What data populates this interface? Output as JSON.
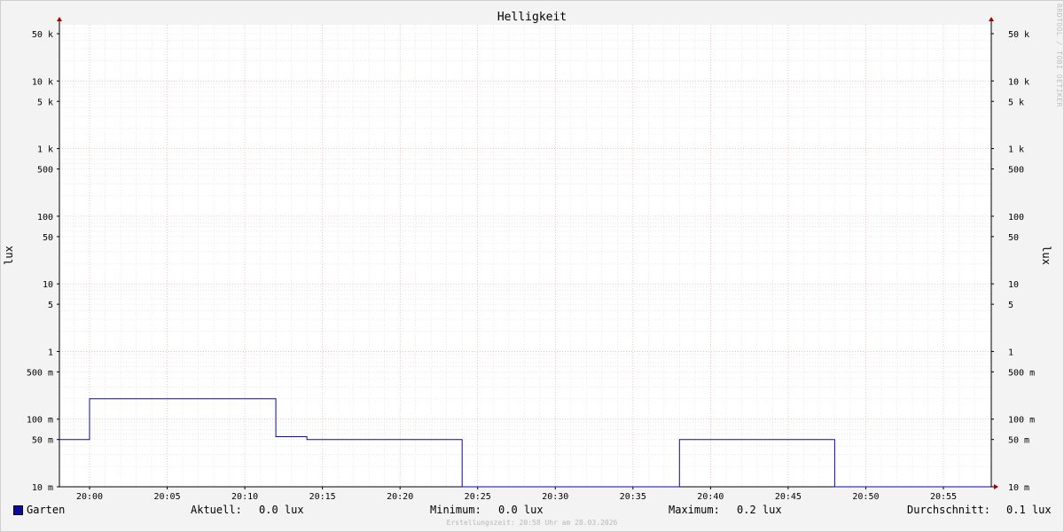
{
  "watermark": "RRDTOOL / TOBI OETIKER",
  "legend": {
    "series_name": "Garten",
    "current_label": "Aktuell:",
    "current_value": "0.0 lux",
    "min_label": "Minimum:",
    "min_value": "0.0 lux",
    "max_label": "Maximum:",
    "max_value": "0.2 lux",
    "avg_label": "Durchschnitt:",
    "avg_value": "0.1 lux"
  },
  "credit": "Erstellungszeit: 20:58 Uhr am 28.03.2026",
  "chart_data": {
    "type": "line",
    "title": "Helligkeit",
    "ylabel": "lux",
    "y_scale": "log",
    "ylim": [
      0.01,
      80000
    ],
    "xlim": [
      "19:58",
      "21:58"
    ],
    "grid": true,
    "x_tick_labels": [
      "20:00",
      "20:05",
      "20:10",
      "20:15",
      "20:20",
      "20:25",
      "20:30",
      "20:35",
      "20:40",
      "20:45",
      "20:50",
      "20:55"
    ],
    "y_tick_labels": [
      {
        "value": 50000,
        "label": "50 k"
      },
      {
        "value": 10000,
        "label": "10 k"
      },
      {
        "value": 5000,
        "label": "5 k"
      },
      {
        "value": 1000,
        "label": "1 k"
      },
      {
        "value": 500,
        "label": "500"
      },
      {
        "value": 100,
        "label": "100"
      },
      {
        "value": 50,
        "label": "50"
      },
      {
        "value": 10,
        "label": "10"
      },
      {
        "value": 5,
        "label": "5"
      },
      {
        "value": 1,
        "label": "1"
      },
      {
        "value": 0.5,
        "label": "500 m"
      },
      {
        "value": 0.1,
        "label": "100 m"
      },
      {
        "value": 0.05,
        "label": "50 m"
      },
      {
        "value": 0.01,
        "label": "10 m"
      }
    ],
    "series": [
      {
        "name": "Garten",
        "color": "#0a0aa0",
        "points": [
          {
            "x": "19:58",
            "y": 0.05
          },
          {
            "x": "20:00",
            "y": 0.05
          },
          {
            "x": "20:00",
            "y": 0.2
          },
          {
            "x": "20:12",
            "y": 0.2
          },
          {
            "x": "20:12",
            "y": 0.055
          },
          {
            "x": "20:14",
            "y": 0.055
          },
          {
            "x": "20:14",
            "y": 0.05
          },
          {
            "x": "20:24",
            "y": 0.05
          },
          {
            "x": "20:24",
            "y": 0.01
          },
          {
            "x": "20:38",
            "y": 0.01
          },
          {
            "x": "20:38",
            "y": 0.05
          },
          {
            "x": "20:48",
            "y": 0.05
          },
          {
            "x": "20:48",
            "y": 0.01
          },
          {
            "x": "20:58",
            "y": 0.01
          }
        ]
      }
    ]
  }
}
